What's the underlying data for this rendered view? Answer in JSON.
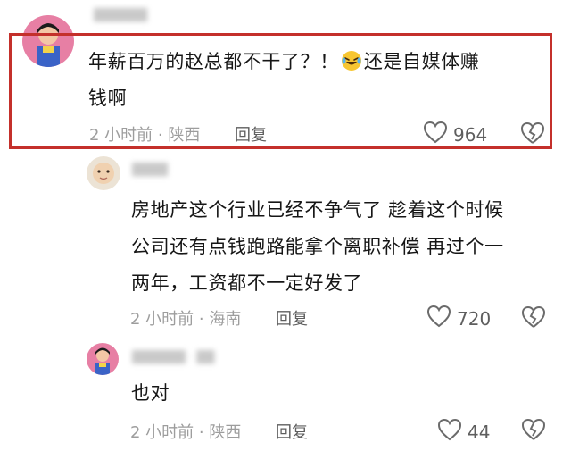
{
  "comments": [
    {
      "text_line1": "年薪百万的赵总都不干了？！",
      "emoji": "laughing-crying-emoji",
      "text_line1_tail": "还是自媒体赚",
      "text_line2": "钱啊",
      "meta": "2 小时前 · 陕西",
      "reply": "回复",
      "likes": "964"
    },
    {
      "text_lines": [
        "房地产这个行业已经不争气了 趁着这个时候",
        "公司还有点钱跑路能拿个离职补偿 再过个一",
        "两年，工资都不一定好发了"
      ],
      "meta": "2 小时前 · 海南",
      "reply": "回复",
      "likes": "720"
    },
    {
      "text_lines": [
        "也对"
      ],
      "meta": "2 小时前 · 陕西",
      "reply": "回复",
      "likes": "44"
    }
  ],
  "colors": {
    "highlight": "#c4302b",
    "meta": "#9d9d9d"
  }
}
